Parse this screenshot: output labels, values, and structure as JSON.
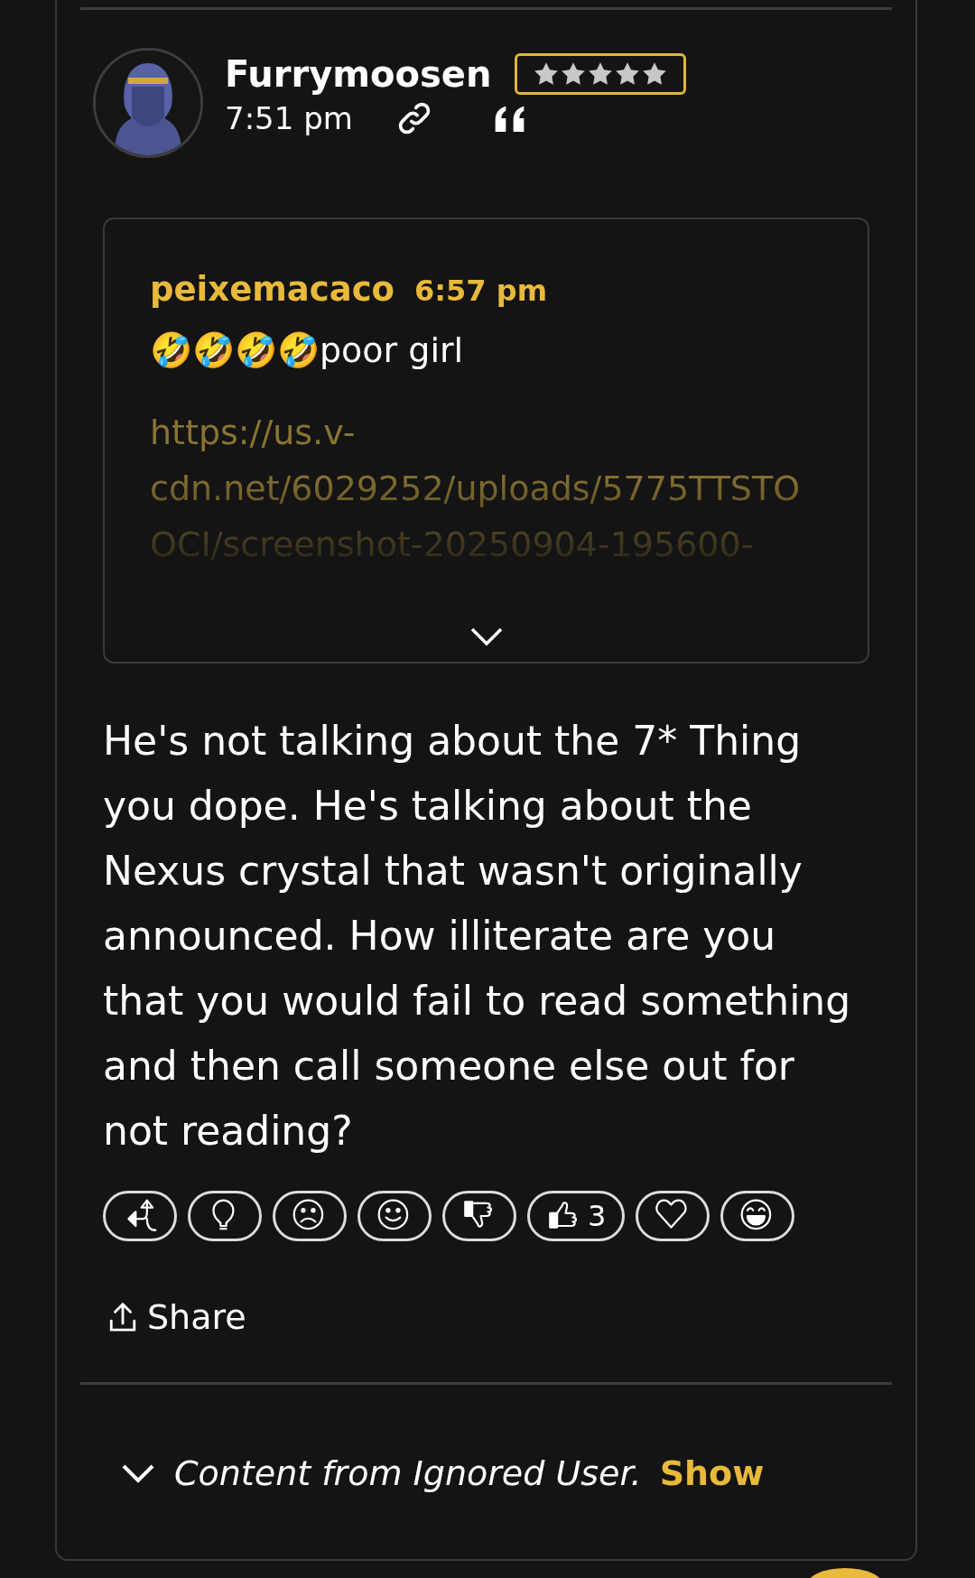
{
  "post": {
    "author": "Furrymoosen",
    "rank": {
      "stars": 5
    },
    "time": "7:51 pm",
    "quote": {
      "author": "peixemacaco",
      "time": "6:57 pm",
      "text": "🤣🤣🤣🤣poor girl",
      "link": "https://us.v-cdn.net/6029252/uploads/5775TTSTOOCI/screenshot-20250904-195600-"
    },
    "body": "He's not talking about the 7* Thing you dope. He's talking about the Nexus crystal that wasn't originally announced. How illiterate are you that you would fail to read something and then call someone else out for not reading?",
    "reactions": [
      {
        "kind": "offtopic"
      },
      {
        "kind": "insightful"
      },
      {
        "kind": "sad"
      },
      {
        "kind": "smile"
      },
      {
        "kind": "dislike"
      },
      {
        "kind": "like",
        "count": "3"
      },
      {
        "kind": "love"
      },
      {
        "kind": "lol"
      }
    ],
    "share": "Share"
  },
  "ignored": {
    "text": "Content from Ignored User.",
    "action": "Show"
  }
}
